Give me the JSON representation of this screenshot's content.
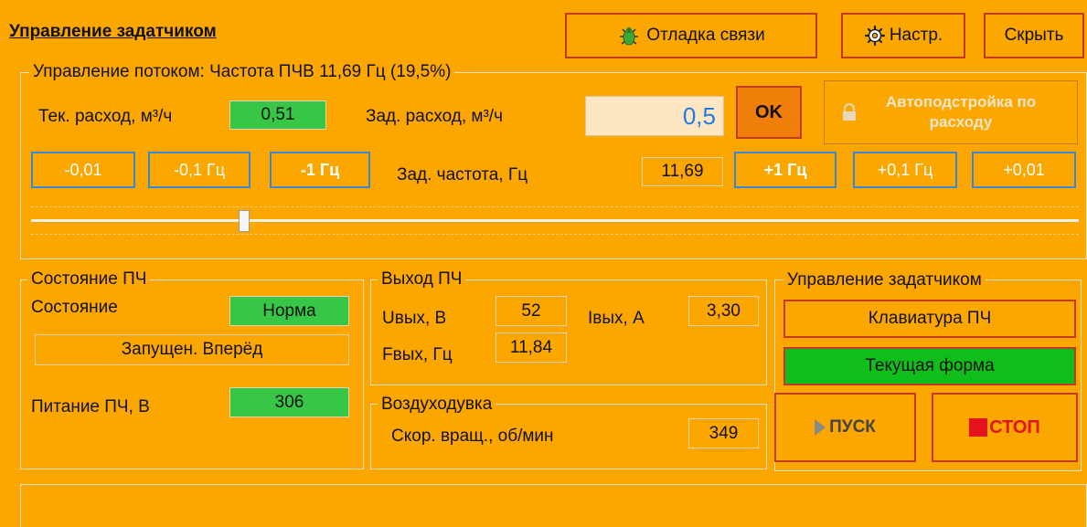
{
  "header": {
    "title": "Управление задатчиком",
    "debug_label": "Отладка связи",
    "settings_label": "Настр.",
    "hide_label": "Скрыть"
  },
  "flow": {
    "group_title": "Управление потоком: Частота ПЧВ 11,69 Гц (19,5%)",
    "cur_flow_label": "Тек. расход, м³/ч",
    "cur_flow_value": "0,51",
    "set_flow_label": "Зад. расход, м³/ч",
    "set_flow_value": "0,5",
    "ok_label": "OK",
    "autotune_label": "Автоподстройка по расходу",
    "steps_minus": [
      "-0,01",
      "-0,1 Гц",
      "-1 Гц"
    ],
    "steps_plus": [
      "+1 Гц",
      "+0,1 Гц",
      "+0,01"
    ],
    "set_freq_label": "Зад. частота, Гц",
    "set_freq_value": "11,69"
  },
  "state": {
    "group_title": "Состояние ПЧ",
    "state_label": "Состояние",
    "state_value": "Норма",
    "running_value": "Запущен. Вперёд",
    "supply_label": "Питание ПЧ, В",
    "supply_value": "306"
  },
  "output": {
    "group_title": "Выход ПЧ",
    "u_label": "Uвых, В",
    "u_value": "52",
    "i_label": "Iвых, А",
    "i_value": "3,30",
    "f_label": "Fвых, Гц",
    "f_value": "11,84"
  },
  "blower": {
    "group_title": "Воздуходувка",
    "speed_label": "Скор. вращ., об/мин",
    "speed_value": "349"
  },
  "control": {
    "group_title": "Управление задатчиком",
    "keyboard_label": "Клавиатура ПЧ",
    "current_form_label": "Текущая форма",
    "start_label": "ПУСК",
    "stop_label": "СТОП"
  },
  "slider": {
    "fraction": 0.2
  },
  "colors": {
    "background": "#fca600",
    "green": "#37c646",
    "current_form_green": "#0fbe1b",
    "ok_button": "#f07f0a",
    "input_bg": "#fde6c2",
    "input_text": "#1e7be8",
    "step_blue": "#3a87d4",
    "stop_red": "#e3141b"
  }
}
